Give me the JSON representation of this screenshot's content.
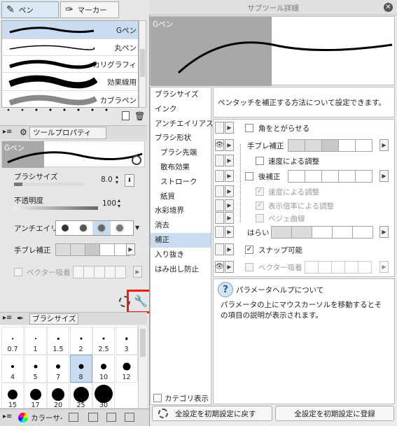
{
  "left_top": {
    "tabs": [
      {
        "label": "ペン",
        "selected": true
      },
      {
        "label": "マーカー",
        "selected": false
      }
    ],
    "brushes": [
      {
        "name": "Gペン",
        "selected": true
      },
      {
        "name": "丸ペン",
        "selected": false
      },
      {
        "name": "カリグラフィ",
        "selected": false
      },
      {
        "name": "効果線用",
        "selected": false
      },
      {
        "name": "カブラペン",
        "selected": false
      }
    ]
  },
  "tool_property": {
    "title": "ツールプロパティ",
    "preview_name": "Gペン",
    "brush_size_label": "ブラシサイズ",
    "brush_size_value": "8.0",
    "opacity_label": "不透明度",
    "opacity_value": "100",
    "antialias_label": "アンチエイリア",
    "stabilization_label": "手ブレ補正",
    "vector_snap_label": "ベクター吸着"
  },
  "brush_size_panel": {
    "title": "ブラシサイズ",
    "sizes": [
      "0.7",
      "1",
      "1.5",
      "2",
      "2.5",
      "3",
      "4",
      "5",
      "7",
      "8",
      "10",
      "12",
      "15",
      "17",
      "20",
      "25",
      "30"
    ],
    "selected": "8"
  },
  "bottom_bar": {
    "color_tab": "カラーサ-"
  },
  "sub_tool_detail": {
    "title": "サブツール詳細",
    "preview_name": "Gペン",
    "description": "ペンタッチを補正する方法について設定できます。",
    "categories": [
      {
        "label": "ブラシサイズ",
        "sub": false,
        "selected": false
      },
      {
        "label": "インク",
        "sub": false,
        "selected": false
      },
      {
        "label": "アンチエイリアス",
        "sub": false,
        "selected": false
      },
      {
        "label": "ブラシ形状",
        "sub": false,
        "selected": false
      },
      {
        "label": "ブラシ先端",
        "sub": true,
        "selected": false
      },
      {
        "label": "散布効果",
        "sub": true,
        "selected": false
      },
      {
        "label": "ストローク",
        "sub": true,
        "selected": false
      },
      {
        "label": "紙質",
        "sub": true,
        "selected": false
      },
      {
        "label": "水彩境界",
        "sub": false,
        "selected": false
      },
      {
        "label": "消去",
        "sub": false,
        "selected": false
      },
      {
        "label": "補正",
        "sub": false,
        "selected": true
      },
      {
        "label": "入り抜き",
        "sub": false,
        "selected": false
      },
      {
        "label": "はみ出し防止",
        "sub": false,
        "selected": false
      }
    ],
    "settings": {
      "sharp_corners": "角をとがらせる",
      "stabilization": "手ブレ補正",
      "speed_adjust_1": "速度による調整",
      "post_correction": "後補正",
      "speed_adjust_2": "速度による調整",
      "zoom_adjust": "表示倍率による調整",
      "bezier": "ベジェ曲線",
      "harai": "はらい",
      "snap": "スナップ可能",
      "vector_snap": "ベクター吸着"
    },
    "help_title": "パラメータヘルプについて",
    "help_text": "パラメータの上にマウスカーソルを移動するとその項目の説明が表示されます。",
    "show_category": "カテゴリ表示",
    "reset_button": "全設定を初期設定に戻す",
    "register_button": "全設定を初期設定に登録"
  },
  "colors": {
    "highlight_red": "#e8201a",
    "selected_blue": "#c9dcf0",
    "preview_gray": "#a8a8a8"
  }
}
